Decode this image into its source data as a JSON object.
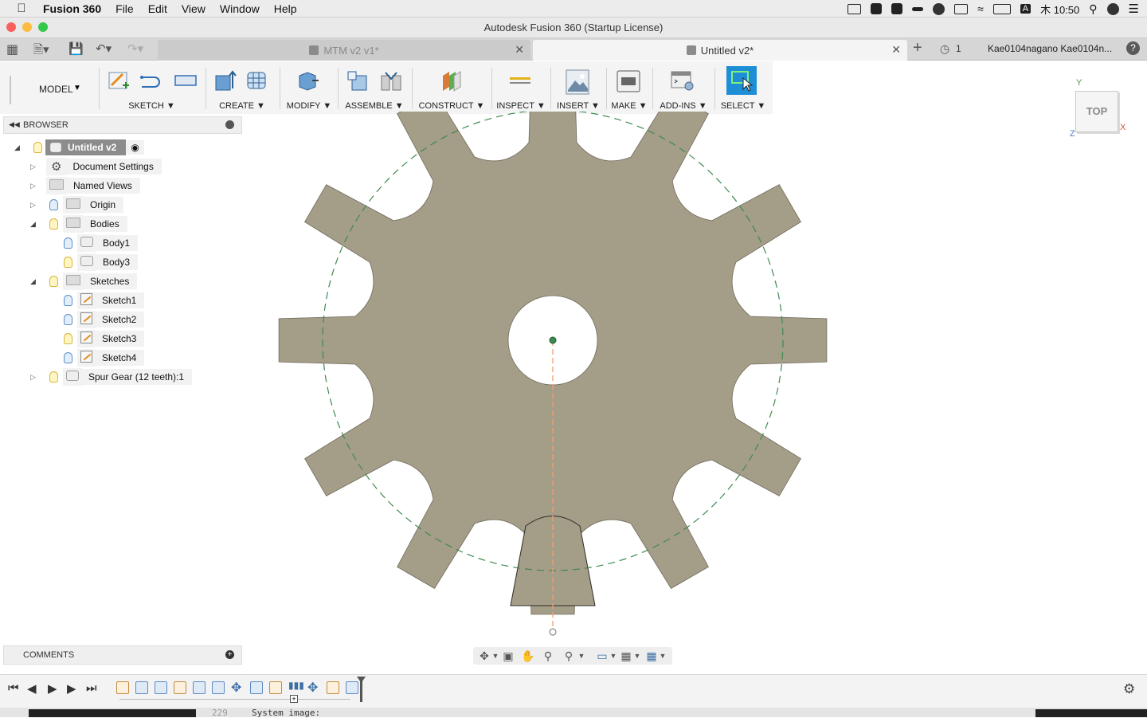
{
  "menubar": {
    "app_name": "Fusion 360",
    "items": [
      "File",
      "Edit",
      "View",
      "Window",
      "Help"
    ],
    "time": "木 10:50",
    "input_indicator": "A"
  },
  "window": {
    "title": "Autodesk Fusion 360 (Startup License)"
  },
  "tabs": [
    {
      "label": "MTM v2 v1*",
      "active": false
    },
    {
      "label": "Untitled v2*",
      "active": true
    }
  ],
  "tabbar": {
    "jobs_count": "1",
    "user": "Kae0104nagano Kae0104n..."
  },
  "toolbar": {
    "workspace": "MODEL",
    "groups": [
      "SKETCH",
      "CREATE",
      "MODIFY",
      "ASSEMBLE",
      "CONSTRUCT",
      "INSPECT",
      "INSERT",
      "MAKE",
      "ADD-INS",
      "SELECT"
    ]
  },
  "browser": {
    "title": "BROWSER",
    "root": "Untitled v2",
    "items": [
      {
        "label": "Document Settings"
      },
      {
        "label": "Named Views"
      },
      {
        "label": "Origin"
      },
      {
        "label": "Bodies"
      },
      {
        "label": "Body1"
      },
      {
        "label": "Body3"
      },
      {
        "label": "Sketches"
      },
      {
        "label": "Sketch1"
      },
      {
        "label": "Sketch2"
      },
      {
        "label": "Sketch3"
      },
      {
        "label": "Sketch4"
      },
      {
        "label": "Spur Gear (12 teeth):1"
      }
    ]
  },
  "viewcube": {
    "face": "TOP",
    "axis_x": "X",
    "axis_y": "Y",
    "axis_z": "Z"
  },
  "comments": {
    "title": "COMMENTS"
  },
  "terminal_peek": {
    "line_no": "229",
    "text": "System image:"
  },
  "colors": {
    "gear_fill": "#a49d88",
    "select_blue": "#1e8fd6",
    "pitch_circle": "#3e8a4f",
    "axis_line": "#f0a070"
  }
}
